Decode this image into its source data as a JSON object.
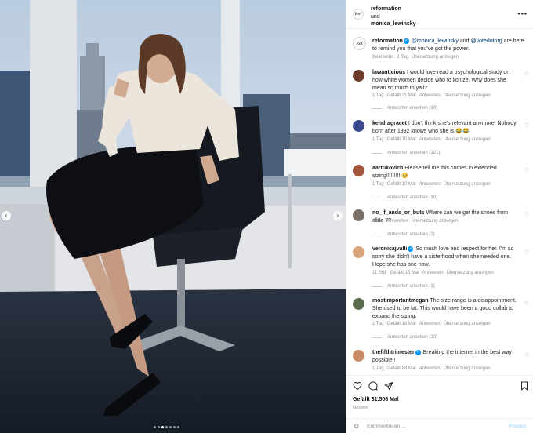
{
  "header": {
    "username": "reformation",
    "joiner": "und",
    "collaborator": "monica_lewinsky",
    "more_icon": "more-horizontal-icon"
  },
  "caption": {
    "username": "reformation",
    "mention1": "@monica_lewinsky",
    "and_text": "and",
    "mention2": "@votedotorg",
    "text": "are here to remind you that you've got the power.",
    "edited": "Bearbeitet",
    "time": "1 Tag",
    "translate": "Übersetzung anzeigen"
  },
  "comments": [
    {
      "username": "lawanticious",
      "text": "I would love read a psychological study on how white women decide who to lionize. Why does she mean so much to yall?",
      "time": "1 Tag",
      "likes": "Gefällt 21 Mal",
      "reply": "Antworten",
      "translate": "Übersetzung anzeigen",
      "replies": "Antworten ansehen (10)",
      "avatar_color": "#6b3a2a"
    },
    {
      "username": "kendragracet",
      "text": "I don't think she's relevant anymore. Nobody born after 1992 knows who she is 😂😂",
      "time": "1 Tag",
      "likes": "Gefällt 70 Mal",
      "reply": "Antworten",
      "translate": "Übersetzung anzeigen",
      "replies": "Antworten ansehen (121)",
      "avatar_color": "#3b4a8c"
    },
    {
      "username": "aartukovich",
      "text": "Please tell me this comes in extended sizing!!!!!!!!! 🥺",
      "time": "1 Tag",
      "likes": "Gefällt 10 Mal",
      "reply": "Antworten",
      "translate": "Übersetzung anzeigen",
      "replies": "Antworten ansehen (10)",
      "avatar_color": "#a4553f"
    },
    {
      "username": "no_if_ands_or_buts",
      "text": "Where can we get the shoes from slide 7?",
      "time": "1 Tag",
      "likes": "",
      "reply": "Antworten",
      "translate": "Übersetzung anzeigen",
      "replies": "Antworten ansehen (2)",
      "avatar_color": "#7a6f66"
    },
    {
      "username": "veronicajvalli",
      "text": "So much love and respect for her. I'm so sorry she didn't have a sisterhood when she needed one. Hope she has one now.",
      "time": "11 Std.",
      "likes": "Gefällt 15 Mal",
      "reply": "Antworten",
      "translate": "Übersetzung anzeigen",
      "replies": "Antworten ansehen (1)",
      "avatar_color": "#d9a47a"
    },
    {
      "username": "mostimportantmegan",
      "text": "The size range is a disappointment. She used to be fat. This would have been a good collab to expand the sizing.",
      "time": "1 Tag",
      "likes": "Gefällt 18 Mal",
      "reply": "Antworten",
      "translate": "Übersetzung anzeigen",
      "replies": "Antworten ansehen (13)",
      "avatar_color": "#5a6b4e"
    },
    {
      "username": "thefifthtrimester",
      "text": "Breaking the internet in the best way possible!!",
      "time": "1 Tag",
      "likes": "Gefällt 88 Mal",
      "reply": "Antworten",
      "translate": "Übersetzung anzeigen",
      "replies": "",
      "avatar_color": "#c98b63"
    }
  ],
  "actions": {
    "likes": "Gefällt 31.506 Mal",
    "date": "Gestern"
  },
  "add_comment": {
    "placeholder": "Kommentieren ...",
    "post_label": "Posten"
  }
}
